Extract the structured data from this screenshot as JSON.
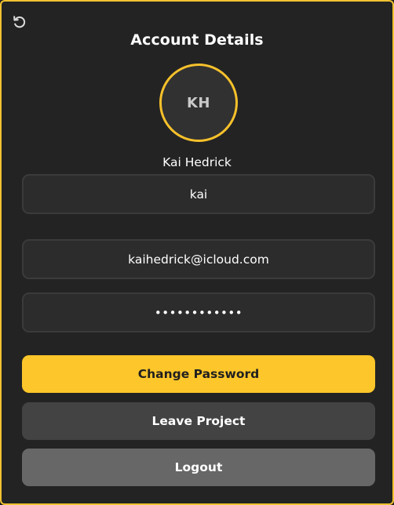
{
  "header": {
    "back_icon": "undo-arrow-icon",
    "title": "Account Details"
  },
  "profile": {
    "initials": "KH",
    "full_name": "Kai Hedrick"
  },
  "form": {
    "username_value": "kai",
    "email_value": "kaihedrick@icloud.com",
    "password_value": "••••••••••••"
  },
  "actions": {
    "change_password_label": "Change Password",
    "leave_project_label": "Leave Project",
    "logout_label": "Logout"
  },
  "colors": {
    "accent": "#fdc62a",
    "background": "#232323",
    "field_bg": "#2c2c2c",
    "leave_bg": "#434343",
    "logout_bg": "#676767"
  }
}
